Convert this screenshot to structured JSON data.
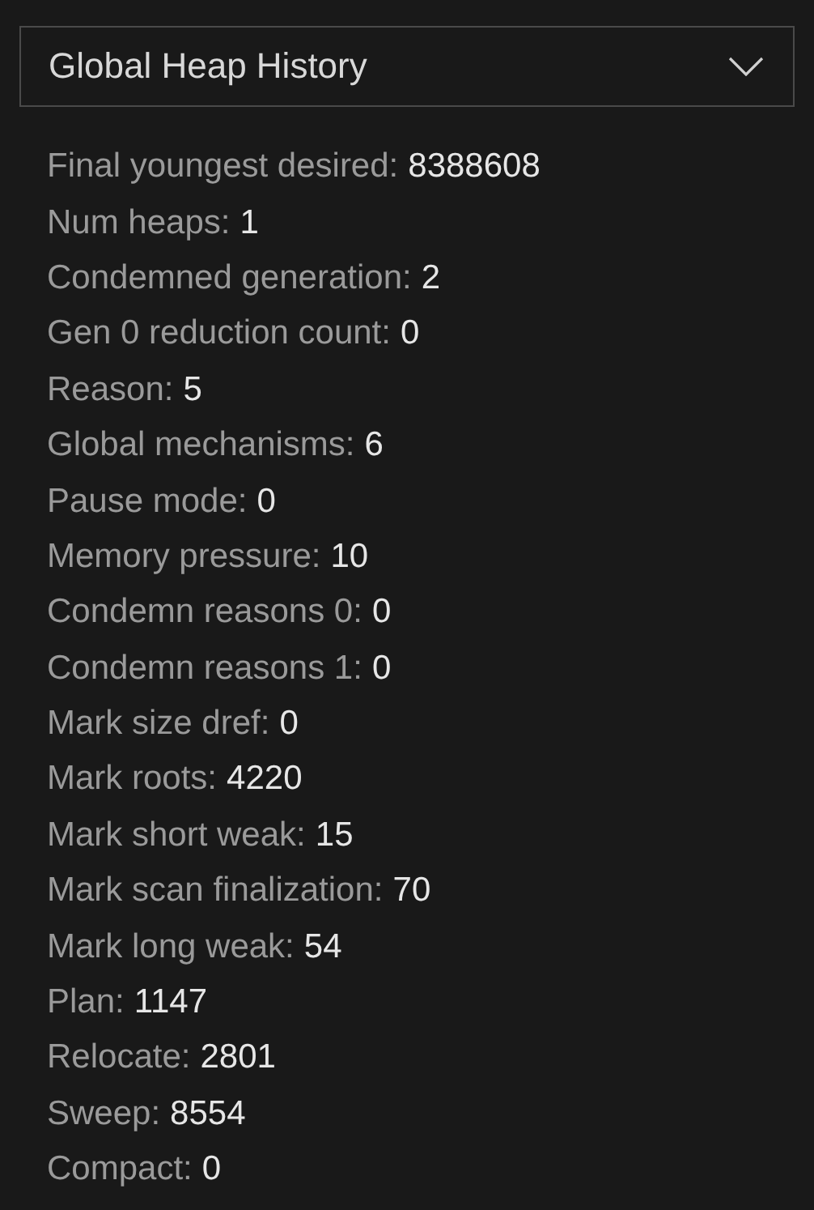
{
  "dropdown": {
    "value": "Global Heap History"
  },
  "fields": [
    {
      "label": "Final youngest desired:",
      "value": "8388608"
    },
    {
      "label": "Num heaps:",
      "value": "1"
    },
    {
      "label": "Condemned generation:",
      "value": "2"
    },
    {
      "label": "Gen 0 reduction count:",
      "value": "0"
    },
    {
      "label": "Reason:",
      "value": "5"
    },
    {
      "label": "Global mechanisms:",
      "value": "6"
    },
    {
      "label": "Pause mode:",
      "value": "0"
    },
    {
      "label": "Memory pressure:",
      "value": "10"
    },
    {
      "label": "Condemn reasons 0:",
      "value": "0"
    },
    {
      "label": "Condemn reasons 1:",
      "value": "0"
    },
    {
      "label": "Mark size dref:",
      "value": "0"
    },
    {
      "label": "Mark roots:",
      "value": "4220"
    },
    {
      "label": "Mark short weak:",
      "value": "15"
    },
    {
      "label": "Mark scan finalization:",
      "value": "70"
    },
    {
      "label": "Mark long weak:",
      "value": "54"
    },
    {
      "label": "Plan:",
      "value": "1147"
    },
    {
      "label": "Relocate:",
      "value": "2801"
    },
    {
      "label": "Sweep:",
      "value": "8554"
    },
    {
      "label": "Compact:",
      "value": "0"
    }
  ]
}
